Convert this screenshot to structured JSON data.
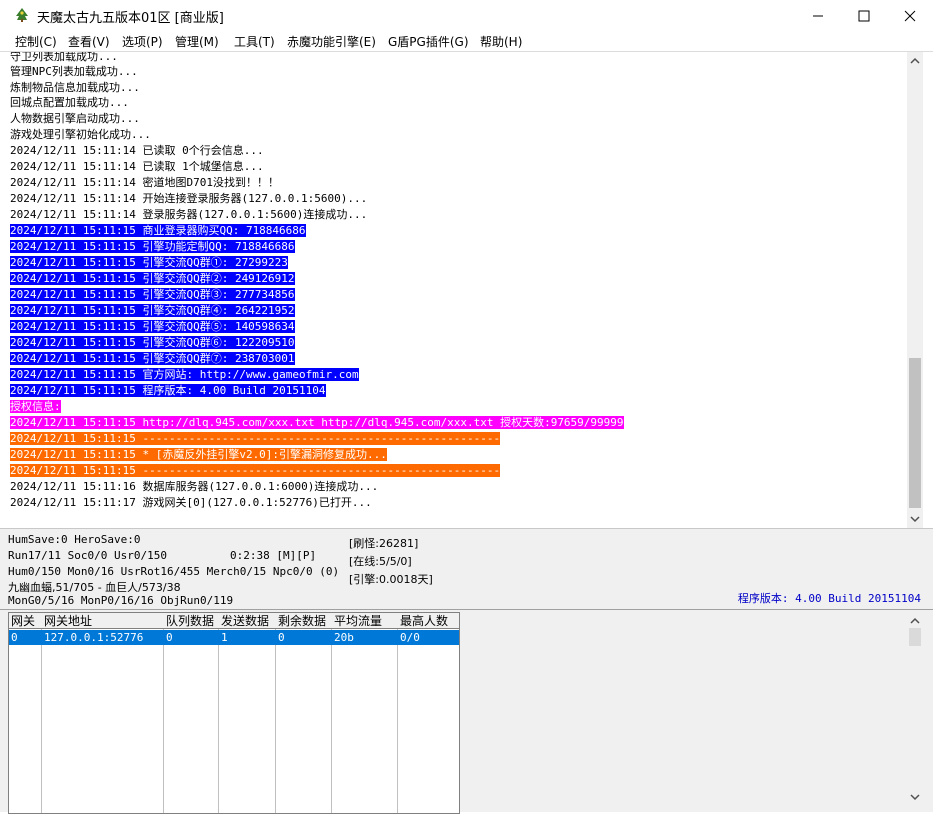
{
  "window": {
    "title": "天魔太古九五版本01区 [商业版]",
    "icon": "tree-app-icon",
    "controls": [
      "minimize-icon",
      "maximize-icon",
      "close-icon"
    ]
  },
  "menu": [
    {
      "label": "控制(C)"
    },
    {
      "label": "查看(V)"
    },
    {
      "label": "选项(P)"
    },
    {
      "label": "管理(M)"
    },
    {
      "label": "工具(T)"
    },
    {
      "label": "赤魔功能引擎(E)"
    },
    {
      "label": "G盾PG插件(G)"
    },
    {
      "label": "帮助(H)"
    }
  ],
  "log": [
    {
      "text": "守卫列表加载成功...",
      "color": "none"
    },
    {
      "text": "管理NPC列表加载成功...",
      "color": "none"
    },
    {
      "text": "炼制物品信息加载成功...",
      "color": "none"
    },
    {
      "text": "回城点配置加载成功...",
      "color": "none"
    },
    {
      "text": "人物数据引擎启动成功...",
      "color": "none"
    },
    {
      "text": "游戏处理引擎初始化成功...",
      "color": "none"
    },
    {
      "text": "2024/12/11 15:11:14 已读取 0个行会信息...",
      "color": "none"
    },
    {
      "text": "2024/12/11 15:11:14 已读取 1个城堡信息...",
      "color": "none"
    },
    {
      "text": "2024/12/11 15:11:14 密道地图D701没找到！！！",
      "color": "none"
    },
    {
      "text": "2024/12/11 15:11:14 开始连接登录服务器(127.0.0.1:5600)...",
      "color": "none"
    },
    {
      "text": "2024/12/11 15:11:14 登录服务器(127.0.0.1:5600)连接成功...",
      "color": "none"
    },
    {
      "text": "2024/12/11 15:11:15 商业登录器购买QQ: 718846686",
      "color": "blue"
    },
    {
      "text": "2024/12/11 15:11:15 引擎功能定制QQ: 718846686",
      "color": "blue"
    },
    {
      "text": "2024/12/11 15:11:15 引擎交流QQ群①: 27299223",
      "color": "blue"
    },
    {
      "text": "2024/12/11 15:11:15 引擎交流QQ群②: 249126912",
      "color": "blue"
    },
    {
      "text": "2024/12/11 15:11:15 引擎交流QQ群③: 277734856",
      "color": "blue"
    },
    {
      "text": "2024/12/11 15:11:15 引擎交流QQ群④: 264221952",
      "color": "blue"
    },
    {
      "text": "2024/12/11 15:11:15 引擎交流QQ群⑤: 140598634",
      "color": "blue"
    },
    {
      "text": "2024/12/11 15:11:15 引擎交流QQ群⑥: 122209510",
      "color": "blue"
    },
    {
      "text": "2024/12/11 15:11:15 引擎交流QQ群⑦: 238703001",
      "color": "blue"
    },
    {
      "text": "2024/12/11 15:11:15 官方网站: http://www.gameofmir.com",
      "color": "blue"
    },
    {
      "text": "2024/12/11 15:11:15 程序版本: 4.00 Build 20151104",
      "color": "blue"
    },
    {
      "text": "授权信息:",
      "color": "magenta"
    },
    {
      "text": "2024/12/11 15:11:15 http://dlq.945.com/xxx.txt http://dlq.945.com/xxx.txt 授权天数:97659/99999",
      "color": "magenta"
    },
    {
      "text": "2024/12/11 15:11:15 ------------------------------------------------------",
      "color": "orange"
    },
    {
      "text": "2024/12/11 15:11:15 * [赤魔反外挂引擎v2.0]:引擎漏洞修复成功...",
      "color": "orange"
    },
    {
      "text": "2024/12/11 15:11:15 ------------------------------------------------------",
      "color": "orange"
    },
    {
      "text": "2024/12/11 15:11:16 数据库服务器(127.0.0.1:6000)连接成功...",
      "color": "none"
    },
    {
      "text": "2024/12/11 15:11:17 游戏网关[0](127.0.0.1:52776)已打开...",
      "color": "none"
    }
  ],
  "status": {
    "line1": "HumSave:0 HeroSave:0",
    "line2a": "Run17/11 Soc0/0 Usr0/150",
    "line2b": "0:2:38 [M][P]",
    "line3": "Hum0/150 Mon0/16 UsrRot16/455 Merch0/15 Npc0/0 (0)",
    "line4": "九幽血蝠,51/705 - 血巨人/573/38",
    "line5": "MonG0/5/16 MonP0/16/16 ObjRun0/119",
    "refresh": "[刷怪:26281]",
    "online": "[在线:5/5/0]",
    "engine": "[引擎:0.0018天]",
    "version": "程序版本: 4.00 Build 20151104"
  },
  "gateway_table": {
    "headers": [
      "网关",
      "网关地址",
      "队列数据",
      "发送数据",
      "剩余数据",
      "平均流量",
      "最高人数"
    ],
    "rows": [
      [
        "0",
        "127.0.0.1:52776",
        "0",
        "1",
        "0",
        "20b",
        "0/0"
      ]
    ]
  },
  "colors": {
    "blue": "#0000ff",
    "magenta": "#ff00ff",
    "orange": "#ff6a00",
    "selection": "#0078d7",
    "version_text": "#0000c8"
  }
}
